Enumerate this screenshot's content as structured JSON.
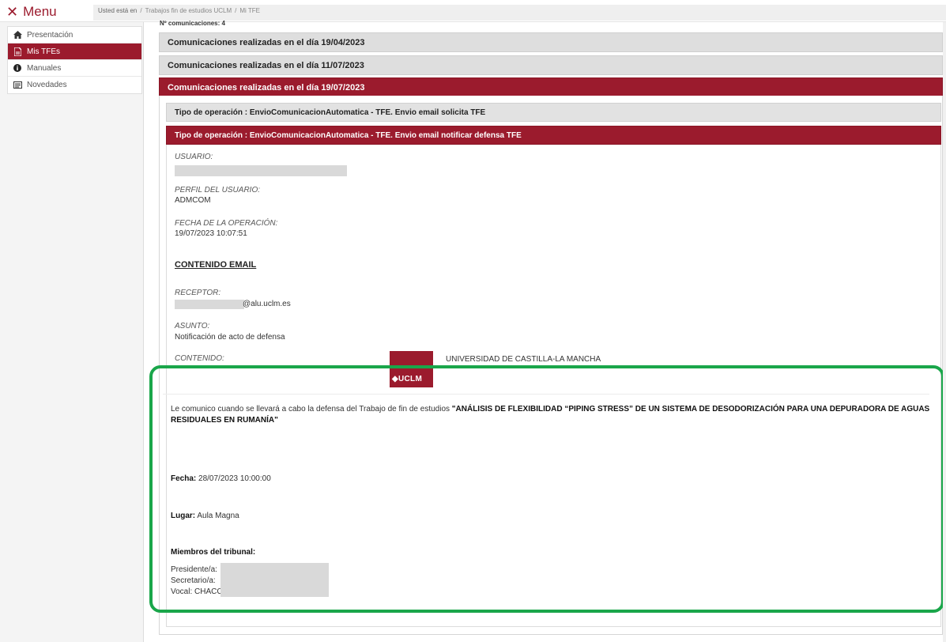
{
  "topbar": {
    "menu_label": "Menu",
    "breadcrumb_prefix": "Usted está en",
    "breadcrumb_sep": "/",
    "breadcrumb_items": [
      "Trabajos fin de estudios UCLM",
      "Mi TFE"
    ]
  },
  "sidebar": {
    "items": [
      {
        "label": "Presentación",
        "icon": "home-icon"
      },
      {
        "label": "Mis TFEs",
        "icon": "document-icon"
      },
      {
        "label": "Manuales",
        "icon": "info-icon"
      },
      {
        "label": "Novedades",
        "icon": "news-icon"
      }
    ]
  },
  "main": {
    "ncom_label": "Nº comunicaciones: 4",
    "panels": [
      {
        "title": "Comunicaciones realizadas en el día 19/04/2023"
      },
      {
        "title": "Comunicaciones realizadas en el día 11/07/2023"
      },
      {
        "title": "Comunicaciones realizadas en el día 19/07/2023"
      }
    ],
    "operations": [
      {
        "title": "Tipo de operación : EnvioComunicacionAutomatica - TFE. Envio email solicita TFE"
      },
      {
        "title": "Tipo de operación : EnvioComunicacionAutomatica - TFE. Envio email notificar defensa TFE"
      }
    ],
    "detail": {
      "usuario_label": "USUARIO:",
      "perfil_label": "PERFIL DEL USUARIO:",
      "perfil_value": "ADMCOM",
      "fecha_label": "FECHA DE LA OPERACIÓN:",
      "fecha_value": "19/07/2023 10:07:51",
      "contenido_email_title": "CONTENIDO EMAIL",
      "receptor_label": "RECEPTOR:",
      "receptor_value": "@alu.uclm.es",
      "asunto_label": "ASUNTO:",
      "asunto_value": "Notificación de acto de defensa",
      "contenido_label": "CONTENIDO:"
    },
    "letter": {
      "logo_text": "◆UCLM",
      "university": "UNIVERSIDAD DE CASTILLA-LA MANCHA",
      "intro": "Le comunico cuando se llevará a cabo la defensa del Trabajo de fin de estudios",
      "title": "\"ANÁLISIS DE FLEXIBILIDAD “PIPING STRESS” DE UN SISTEMA DE DESODORIZACIÓN PARA UNA DEPURADORA DE AGUAS RESIDUALES EN RUMANÍA\"",
      "fecha_label": "Fecha:",
      "fecha_value": "28/07/2023 10:00:00",
      "lugar_label": "Lugar:",
      "lugar_value": "Aula Magna",
      "miembros_label": "Miembros del tribunal:",
      "presidente_label": "Presidente/a:",
      "secretario_label": "Secretario/a:",
      "vocal_label": "Vocal: CHACC"
    }
  },
  "colors": {
    "accent": "#9b1b2d",
    "highlight": "#1aa64a"
  }
}
